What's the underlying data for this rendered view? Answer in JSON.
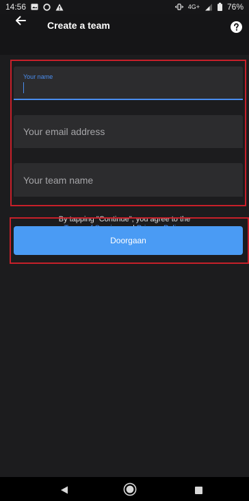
{
  "status_bar": {
    "time": "14:56",
    "network": "4G+",
    "battery": "76%",
    "icons": [
      "image-icon",
      "circle-icon",
      "warning-icon",
      "vibrate-icon",
      "signal-icon",
      "battery-icon"
    ]
  },
  "app_bar": {
    "title": "Create a team",
    "back_icon": "back-arrow-icon",
    "help_icon": "help-icon"
  },
  "form": {
    "name_label": "Your name",
    "name_value": "",
    "email_placeholder": "Your email address",
    "team_placeholder": "Your team name"
  },
  "terms": {
    "line1": "By tapping \"Continue\", you agree to the",
    "terms_link": "Terms of Service",
    "and_text": " and ",
    "privacy_link": "Privacy Policy",
    "period": "."
  },
  "button": {
    "continue_label": "Doorgaan"
  },
  "colors": {
    "accent": "#4a8ef0",
    "button": "#4a9bf4",
    "highlight_border": "#c8202a",
    "background": "#1c1c1e",
    "field": "#2c2c2e"
  },
  "nav_bar": {
    "icons": [
      "nav-back-icon",
      "nav-home-icon",
      "nav-recents-icon"
    ]
  }
}
